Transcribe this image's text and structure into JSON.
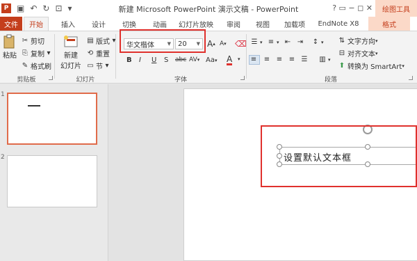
{
  "window": {
    "title": "新建 Microsoft PowerPoint 演示文稿 - PowerPoint",
    "context_tool": "绘图工具",
    "controls": "? ▭ − ◻ ✕"
  },
  "qat": {
    "undo": "↶",
    "redo": "↻"
  },
  "tabs": {
    "file": "文件",
    "home": "开始",
    "insert": "插入",
    "design": "设计",
    "transitions": "切换",
    "animations": "动画",
    "slideshow": "幻灯片放映",
    "review": "审阅",
    "view": "视图",
    "addins": "加载项",
    "endnote": "EndNote X8",
    "format": "格式"
  },
  "ribbon": {
    "clipboard": {
      "paste": "粘贴",
      "cut": "剪切",
      "copy": "复制",
      "format_painter": "格式刷",
      "label": "剪贴板"
    },
    "slides": {
      "new_slide_1": "新建",
      "new_slide_2": "幻灯片",
      "layout": "版式",
      "reset": "重置",
      "section": "节",
      "label": "幻灯片"
    },
    "font": {
      "font_name": "华文楷体",
      "font_size": "20",
      "label": "字体",
      "bold": "B",
      "italic": "I",
      "underline": "U",
      "strike": "S",
      "shadow": "abc",
      "spacing": "AV",
      "case": "Aa",
      "grow": "A",
      "shrink": "A",
      "color": "A"
    },
    "paragraph": {
      "text_direction": "文字方向",
      "align_text": "对齐文本",
      "smartart": "转换为 SmartArt",
      "label": "段落"
    }
  },
  "slides": [
    "1",
    "2"
  ],
  "textbox": {
    "text": "设置默认文本框"
  }
}
